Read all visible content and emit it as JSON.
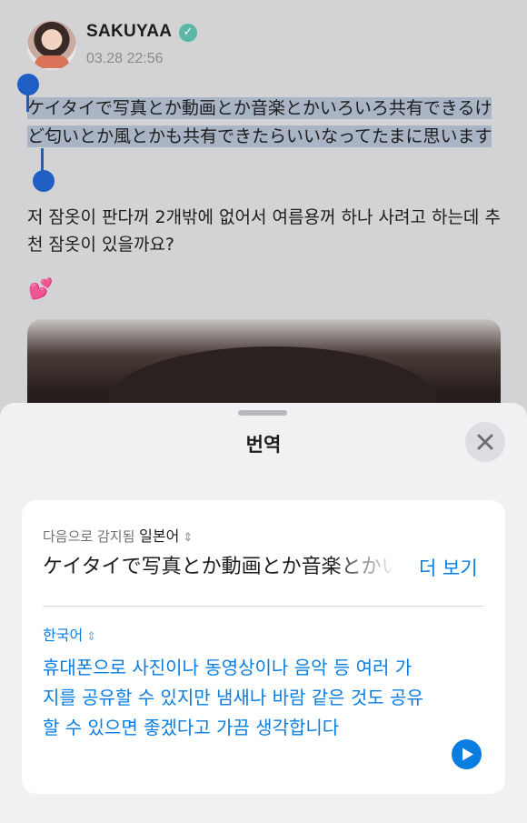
{
  "post": {
    "username": "SAKUYAA",
    "verified_icon": "verified-badge-icon",
    "timestamp": "03.28 22:56",
    "text_selected": "ケイタイで写真とか動画とか音楽とかいろいろ共有できるけど匂いとか風とかも共有できたらいいなってたまに思います",
    "text_korean": "저 잠옷이 판다꺼 2개밖에 없어서 여름용꺼 하나 사려고 하는데 추천 잠옷이 있을까요?",
    "emoji": "💕"
  },
  "sheet": {
    "title": "번역",
    "close_icon": "close-icon",
    "detected_prefix": "다음으로 감지됨",
    "detected_language": "일본어",
    "source_text": "ケイタイで写真とか動画とか音楽とかいろいろ",
    "more_label": "더 보기",
    "target_language": "한국어",
    "translated_text": "휴대폰으로 사진이나 동영상이나 음악 등 여러 가지를 공유할 수 있지만 냄새나 바람 같은 것도 공유할 수 있으면 좋겠다고 가끔 생각합니다",
    "play_icon": "play-icon"
  },
  "colors": {
    "accent": "#0a7de0",
    "selection": "#a9b4c4",
    "selection_handle": "#1f5fc4"
  }
}
